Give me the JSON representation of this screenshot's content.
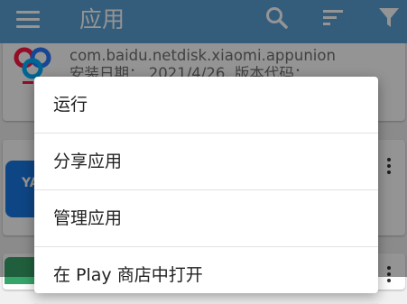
{
  "appbar": {
    "title": "应用",
    "icons": [
      "menu-icon",
      "search-icon",
      "sort-icon",
      "filter-icon"
    ],
    "color": "#5ba0d6"
  },
  "list": {
    "items": [
      {
        "package": "com.baidu.netdisk.xiaomi.appunion",
        "details": "安装日期： 2021/4/26, 版本代码："
      }
    ]
  },
  "popup": {
    "items": [
      "运行",
      "分享应用",
      "管理应用",
      "在 Play 商店中打开"
    ]
  }
}
